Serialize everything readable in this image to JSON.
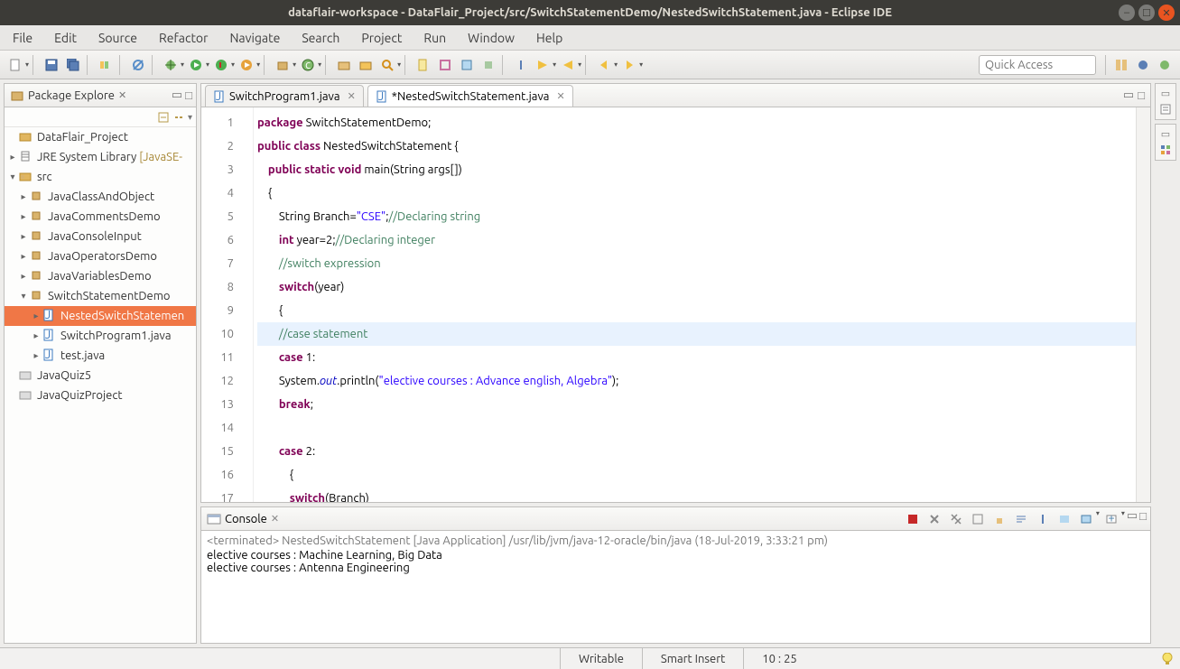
{
  "window": {
    "title": "dataflair-workspace - DataFlair_Project/src/SwitchStatementDemo/NestedSwitchStatement.java - Eclipse IDE"
  },
  "menubar": [
    "File",
    "Edit",
    "Source",
    "Refactor",
    "Navigate",
    "Search",
    "Project",
    "Run",
    "Window",
    "Help"
  ],
  "quick_access_placeholder": "Quick Access",
  "package_explorer": {
    "title": "Package Explore",
    "project": "DataFlair_Project",
    "jre": {
      "label": "JRE System Library",
      "suffix": "[JavaSE-"
    },
    "src": "src",
    "packages": [
      "JavaClassAndObject",
      "JavaCommentsDemo",
      "JavaConsoleInput",
      "JavaOperatorsDemo",
      "JavaVariablesDemo"
    ],
    "open_package": "SwitchStatementDemo",
    "open_package_files": [
      "NestedSwitchStatemen",
      "SwitchProgram1.java",
      "test.java"
    ],
    "other_projects": [
      "JavaQuiz5",
      "JavaQuizProject"
    ]
  },
  "editor": {
    "tabs": [
      {
        "label": "SwitchProgram1.java",
        "active": false
      },
      {
        "label": "*NestedSwitchStatement.java",
        "active": true
      }
    ],
    "line_numbers": [
      "1",
      "2",
      "3",
      "4",
      "5",
      "6",
      "7",
      "8",
      "9",
      "10",
      "11",
      "12",
      "13",
      "14",
      "15",
      "16",
      "17"
    ],
    "highlighted_line_index": 9,
    "code_tokens": [
      [
        {
          "t": "package",
          "c": "kw"
        },
        {
          "t": " SwitchStatementDemo;",
          "c": ""
        }
      ],
      [
        {
          "t": "public class",
          "c": "kw"
        },
        {
          "t": " NestedSwitchStatement {",
          "c": ""
        }
      ],
      [
        {
          "t": "    ",
          "c": ""
        },
        {
          "t": "public static void",
          "c": "kw"
        },
        {
          "t": " main(String args[])",
          "c": ""
        }
      ],
      [
        {
          "t": "    {",
          "c": ""
        }
      ],
      [
        {
          "t": "        String Branch=",
          "c": ""
        },
        {
          "t": "\"CSE\"",
          "c": "str"
        },
        {
          "t": ";",
          "c": ""
        },
        {
          "t": "//Declaring string",
          "c": "com"
        }
      ],
      [
        {
          "t": "        ",
          "c": ""
        },
        {
          "t": "int",
          "c": "kw"
        },
        {
          "t": " year=2;",
          "c": ""
        },
        {
          "t": "//Declaring integer",
          "c": "com"
        }
      ],
      [
        {
          "t": "        ",
          "c": ""
        },
        {
          "t": "//switch expression",
          "c": "com"
        }
      ],
      [
        {
          "t": "        ",
          "c": ""
        },
        {
          "t": "switch",
          "c": "kw"
        },
        {
          "t": "(year)",
          "c": ""
        }
      ],
      [
        {
          "t": "        {",
          "c": ""
        }
      ],
      [
        {
          "t": "        ",
          "c": ""
        },
        {
          "t": "//case statement",
          "c": "com"
        }
      ],
      [
        {
          "t": "        ",
          "c": ""
        },
        {
          "t": "case",
          "c": "kw"
        },
        {
          "t": " 1:",
          "c": ""
        }
      ],
      [
        {
          "t": "        System.",
          "c": ""
        },
        {
          "t": "out",
          "c": "fld"
        },
        {
          "t": ".println(",
          "c": ""
        },
        {
          "t": "\"elective courses : Advance english, Algebra\"",
          "c": "str"
        },
        {
          "t": ");",
          "c": ""
        }
      ],
      [
        {
          "t": "        ",
          "c": ""
        },
        {
          "t": "break",
          "c": "kw"
        },
        {
          "t": ";",
          "c": ""
        }
      ],
      [
        {
          "t": "",
          "c": ""
        }
      ],
      [
        {
          "t": "        ",
          "c": ""
        },
        {
          "t": "case",
          "c": "kw"
        },
        {
          "t": " 2:",
          "c": ""
        }
      ],
      [
        {
          "t": "            {",
          "c": ""
        }
      ],
      [
        {
          "t": "            ",
          "c": ""
        },
        {
          "t": "switch",
          "c": "kw"
        },
        {
          "t": "(Branch)",
          "c": ""
        }
      ]
    ]
  },
  "console": {
    "title": "Console",
    "status": "<terminated> NestedSwitchStatement [Java Application] /usr/lib/jvm/java-12-oracle/bin/java (18-Jul-2019, 3:33:21 pm)",
    "output": [
      "elective courses : Machine Learning, Big Data",
      "elective courses : Antenna Engineering"
    ]
  },
  "statusbar": {
    "writable": "Writable",
    "insert": "Smart Insert",
    "pos": "10 : 25"
  }
}
